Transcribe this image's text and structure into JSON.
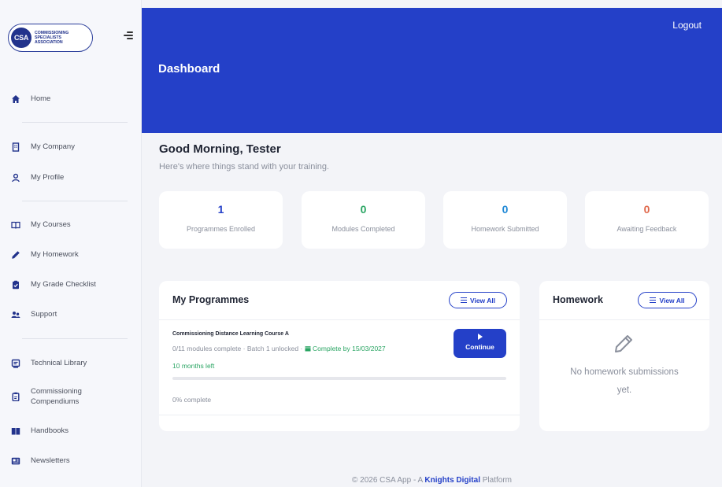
{
  "logo": {
    "badge": "CSA",
    "line1": "COMMISSIONING",
    "line2": "SPECIALISTS",
    "line3": "ASSOCIATION"
  },
  "sidebar": {
    "items": [
      {
        "label": "Home",
        "icon": "home-icon"
      },
      {
        "label": "My Company",
        "icon": "building-icon"
      },
      {
        "label": "My Profile",
        "icon": "user-icon"
      },
      {
        "label": "My Courses",
        "icon": "book-open-icon"
      },
      {
        "label": "My Homework",
        "icon": "pencil-icon"
      },
      {
        "label": "My Grade Checklist",
        "icon": "clipboard-check-icon"
      },
      {
        "label": "Support",
        "icon": "users-icon"
      },
      {
        "label": "Technical Library",
        "icon": "library-icon"
      },
      {
        "label": "Commissioning Compendiums",
        "icon": "clipboard-icon"
      },
      {
        "label": "Handbooks",
        "icon": "books-icon"
      },
      {
        "label": "Newsletters",
        "icon": "newspaper-icon"
      }
    ]
  },
  "header": {
    "logout": "Logout",
    "title": "Dashboard",
    "bg_color": "#2440c8"
  },
  "greeting": {
    "title": "Good Morning,  Tester",
    "subtitle": "Here's where things stand with your training."
  },
  "stats": [
    {
      "value": "1",
      "label": "Programmes Enrolled",
      "color": "#2440c8"
    },
    {
      "value": "0",
      "label": "Modules Completed",
      "color": "#2aa563"
    },
    {
      "value": "0",
      "label": "Homework Submitted",
      "color": "#1e88d6"
    },
    {
      "value": "0",
      "label": "Awaiting Feedback",
      "color": "#e0684b"
    }
  ],
  "programmes": {
    "title": "My Programmes",
    "view_all": "View All",
    "course": {
      "title": "Commissioning Distance Learning Course A",
      "modules": "0/11 modules complete",
      "batch": "Batch 1 unlocked",
      "due": "Complete by 15/03/2027",
      "remaining": "10 months left",
      "progress": 0,
      "progress_label": "0% complete",
      "continue": "Continue"
    }
  },
  "homework": {
    "title": "Homework",
    "view_all": "View All",
    "empty_line1": "No homework submissions",
    "empty_line2": "yet."
  },
  "footer": {
    "prefix": "© 2026 CSA App - A",
    "brand": "Knights Digital",
    "suffix": "Platform"
  }
}
